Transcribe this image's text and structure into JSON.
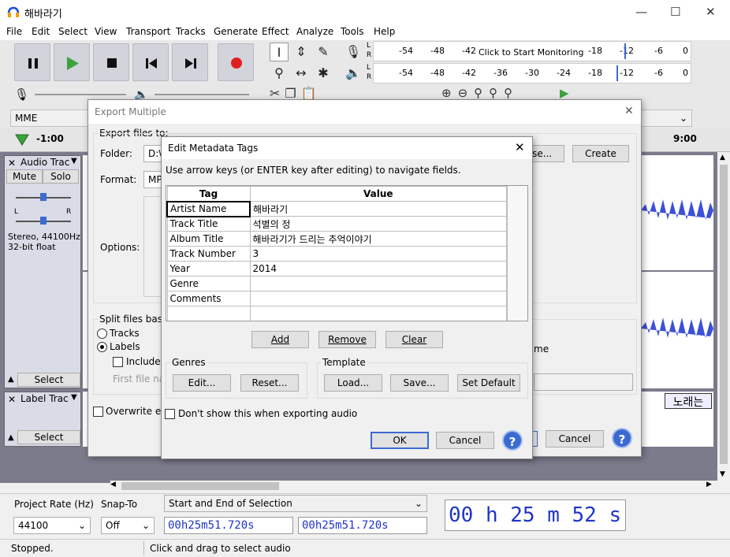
{
  "window": {
    "title": "해바라기"
  },
  "menu": [
    "File",
    "Edit",
    "Select",
    "View",
    "Transport",
    "Tracks",
    "Generate",
    "Effect",
    "Analyze",
    "Tools",
    "Help"
  ],
  "meters": {
    "record_scale": [
      "-54",
      "-48",
      "-42",
      "-18",
      "-12",
      "-6",
      "0"
    ],
    "monitor_text": "Click to Start Monitoring",
    "play_scale": [
      "-54",
      "-48",
      "-42",
      "-36",
      "-30",
      "-24",
      "-18",
      "-12",
      "-6",
      "0"
    ],
    "lr": [
      "L",
      "R"
    ]
  },
  "device": {
    "host": "MME"
  },
  "timeline": {
    "left": "-1:00",
    "right": "9:00"
  },
  "audio_track": {
    "name": "Audio Trac",
    "mute": "Mute",
    "solo": "Solo",
    "info": "Stereo, 44100Hz\n32-bit float",
    "select": "Select",
    "gain_lr": [
      "L",
      "R"
    ]
  },
  "label_track": {
    "name": "Label Trac",
    "select": "Select",
    "label_text": "노래는"
  },
  "export_multiple": {
    "title": "Export Multiple",
    "export_files_to": "Export files to:",
    "folder_label": "Folder:",
    "folder_value": "D:\\",
    "choose": "ose...",
    "create": "Create",
    "format_label": "Format:",
    "format_value": "MP",
    "options_label": "Options:",
    "split_label": "Split files based",
    "tracks": "Tracks",
    "labels": "Labels",
    "include": "Include a",
    "first_file": "First file nan",
    "name_fragment": "me",
    "overwrite": "Overwrite exis",
    "cancel": "Cancel"
  },
  "metadata": {
    "title": "Edit Metadata Tags",
    "hint": "Use arrow keys (or ENTER key after editing) to navigate fields.",
    "col_tag": "Tag",
    "col_value": "Value",
    "rows": [
      {
        "tag": "Artist Name",
        "value": "해바라기"
      },
      {
        "tag": "Track Title",
        "value": "석별의 정"
      },
      {
        "tag": "Album Title",
        "value": "해바라기가 드리는 추억이야기"
      },
      {
        "tag": "Track Number",
        "value": "3"
      },
      {
        "tag": "Year",
        "value": "2014"
      },
      {
        "tag": "Genre",
        "value": ""
      },
      {
        "tag": "Comments",
        "value": ""
      },
      {
        "tag": "",
        "value": ""
      }
    ],
    "add": "Add",
    "remove": "Remove",
    "clear": "Clear",
    "genres": "Genres",
    "edit": "Edit...",
    "reset": "Reset...",
    "template": "Template",
    "load": "Load...",
    "save": "Save...",
    "set_default": "Set Default",
    "dont_show": "Don't show this when exporting audio",
    "ok": "OK",
    "cancel": "Cancel"
  },
  "bottom": {
    "project_rate_label": "Project Rate (Hz)",
    "snap_label": "Snap-To",
    "project_rate": "44100",
    "snap": "Off",
    "selection_mode": "Start and End of Selection",
    "sel_start": "00h25m51.720s",
    "sel_end": "00h25m51.720s",
    "big_time": "00 h 25 m 52 s"
  },
  "status": {
    "left": "Stopped.",
    "right": "Click and drag to select audio"
  },
  "colors": {
    "play": "#3ca23c",
    "record": "#e02020",
    "accent": "#3b6bd1",
    "waveform": "#3c50d8"
  }
}
